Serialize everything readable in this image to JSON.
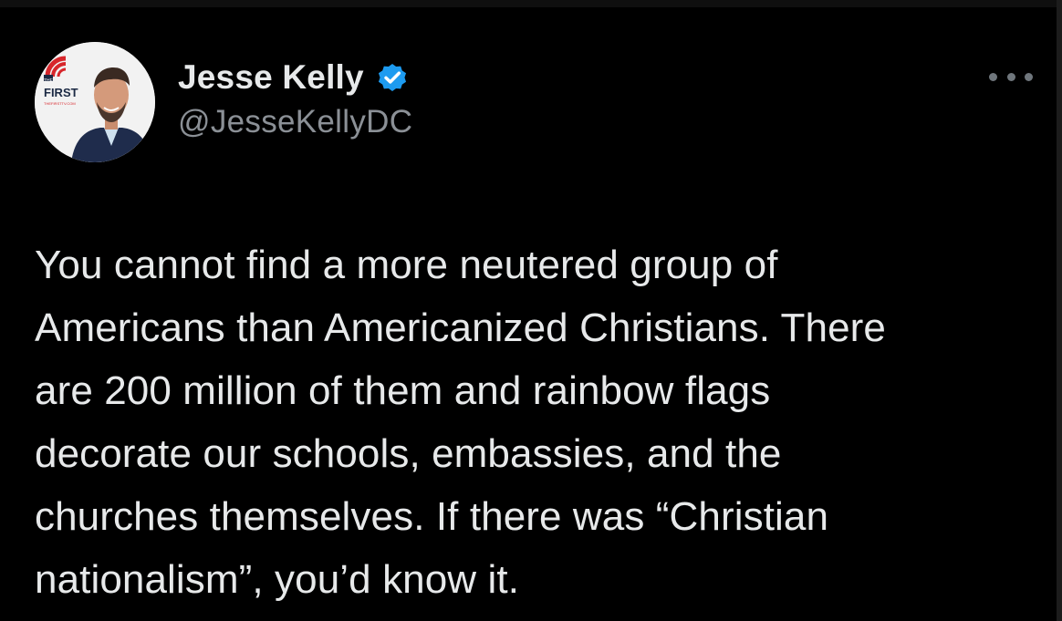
{
  "author": {
    "display_name": "Jesse Kelly",
    "handle": "@JesseKellyDC",
    "verified": true,
    "avatar_badge": {
      "line1": "THE",
      "line2": "FIRST",
      "line3": "THEFIRSTTV.COM"
    }
  },
  "menu": {
    "icon": "more-horizontal-icon"
  },
  "tweet": {
    "lines": [
      "You cannot find a more neutered group of",
      "Americans than Americanized Christians. There",
      "are 200 million of them and rainbow flags",
      "decorate our schools, embassies, and the",
      "churches themselves. If there was “Christian",
      "nationalism”, you’d know it."
    ]
  },
  "colors": {
    "background": "#000000",
    "text_primary": "#e7e9ea",
    "text_secondary": "#8b9096",
    "verified_blue": "#1d9bf0",
    "badge_red": "#d7262b"
  }
}
